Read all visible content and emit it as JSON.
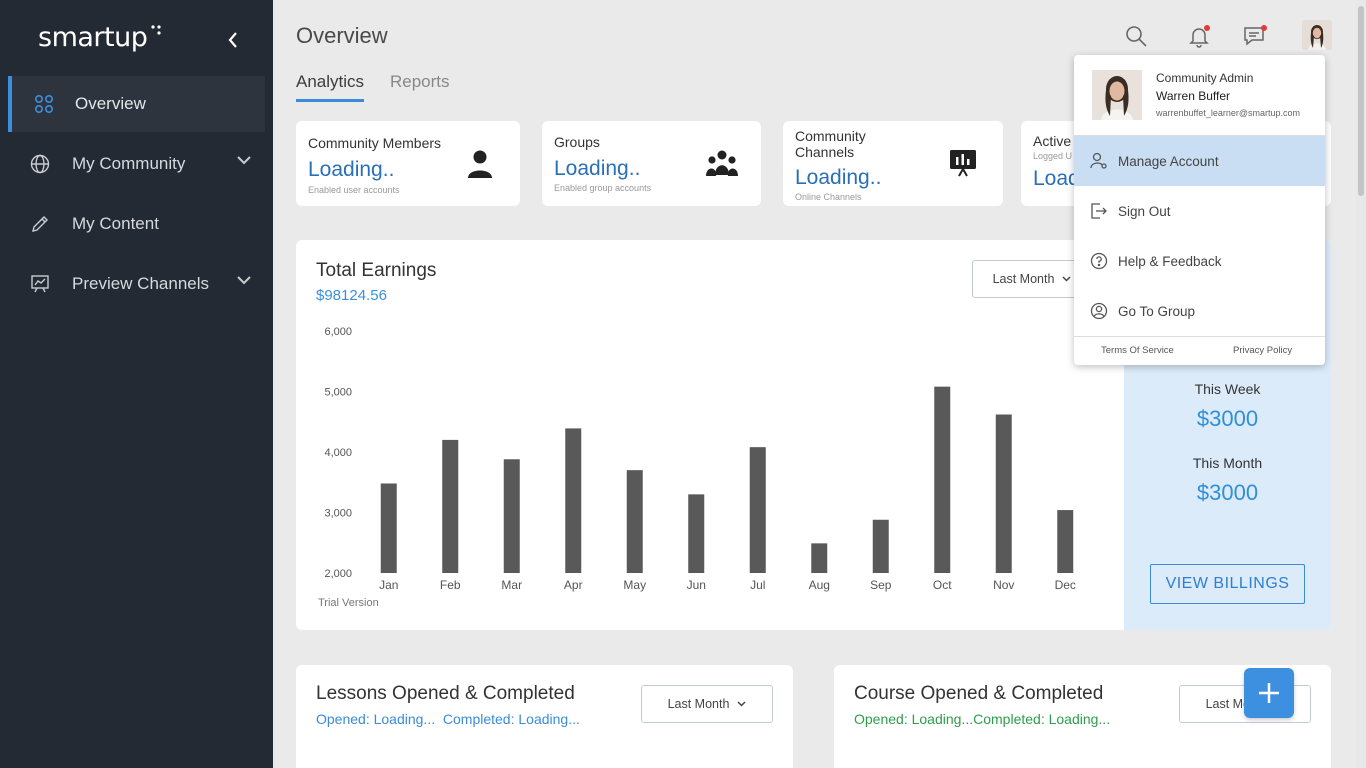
{
  "brand": {
    "name": "smartup"
  },
  "sidebar": {
    "items": [
      {
        "label": "Overview",
        "icon": "grid-icon",
        "active": true
      },
      {
        "label": "My Community",
        "icon": "globe-icon",
        "expandable": true
      },
      {
        "label": "My Content",
        "icon": "pencil-icon"
      },
      {
        "label": "Preview Channels",
        "icon": "presentation-chart-icon",
        "expandable": true
      }
    ]
  },
  "header": {
    "title": "Overview",
    "tabs": [
      {
        "label": "Analytics",
        "active": true
      },
      {
        "label": "Reports",
        "active": false
      }
    ]
  },
  "cards": [
    {
      "title": "Community Members",
      "value": "Loading..",
      "sub": "Enabled user accounts",
      "icon": "person-icon"
    },
    {
      "title": "Groups",
      "value": "Loading..",
      "sub": "Enabled group accounts",
      "icon": "group-icon"
    },
    {
      "title": "Community Channels",
      "value": "Loading..",
      "sub": "Online Channels",
      "icon": "presentation-icon"
    },
    {
      "title": "Active",
      "value": "Load",
      "sub": "Logged U"
    }
  ],
  "earnings": {
    "title": "Total Earnings",
    "amount": "$98124.56",
    "period": "Last Month",
    "trial": "Trial Version",
    "this_week_label": "This Week",
    "this_week_value": "$3000",
    "this_month_label": "This Month",
    "this_month_value": "$3000",
    "view_billings": "VIEW BILLINGS"
  },
  "chart_data": {
    "type": "bar",
    "categories": [
      "Jan",
      "Feb",
      "Mar",
      "Apr",
      "May",
      "Jun",
      "Jul",
      "Aug",
      "Sep",
      "Oct",
      "Nov",
      "Dec"
    ],
    "values": [
      3480,
      4200,
      3880,
      4390,
      3700,
      3300,
      4080,
      2490,
      2880,
      5080,
      4620,
      3040
    ],
    "ylim": [
      2000,
      6000
    ],
    "yticks": [
      "2,000",
      "3,000",
      "4,000",
      "5,000",
      "6,000"
    ],
    "bar_color": "#595959"
  },
  "lessons": {
    "title": "Lessons Opened & Completed",
    "opened": "Opened: Loading...",
    "completed": "Completed: Loading...",
    "period": "Last Month"
  },
  "courses": {
    "title": "Course Opened & Completed",
    "opened": "Opened: Loading...",
    "completed": "Completed: Loading...",
    "period": "Last Month"
  },
  "account_menu": {
    "role": "Community Admin",
    "name": "Warren Buffer",
    "email": "warrenbuffet_learner@smartup.com",
    "items": [
      {
        "label": "Manage Account",
        "icon": "manage-account-icon",
        "highlight": true
      },
      {
        "label": "Sign Out",
        "icon": "sign-out-icon"
      },
      {
        "label": "Help & Feedback",
        "icon": "help-icon"
      },
      {
        "label": "Go To Group",
        "icon": "user-circle-icon"
      }
    ],
    "terms": "Terms Of Service",
    "privacy": "Privacy Policy"
  },
  "colors": {
    "accent": "#3b8bd9",
    "sidebar": "#242a33",
    "green": "#2e9e4a"
  }
}
